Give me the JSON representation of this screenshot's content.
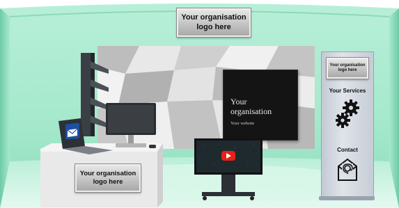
{
  "booth": {
    "top_logo": [
      "Your organisation",
      "logo here"
    ],
    "desk_logo": [
      "Your organisation",
      "logo here"
    ],
    "screen_title": [
      "Your",
      "organisation"
    ],
    "screen_subtitle": "Your website",
    "banner": {
      "logo": [
        "Your organisation",
        "logo here"
      ],
      "services_label": "Your Services",
      "contact_label": "Contact"
    }
  },
  "icons": {
    "email": "envelope-icon",
    "video": "play-icon",
    "services": "gears-icon",
    "contact": "mail-at-icon"
  },
  "colors": {
    "booth_wall": "#9fe6c9",
    "booth_floor": "#c9f3e1",
    "youtube_red": "#e62117",
    "email_blue": "#1f4fa3"
  }
}
